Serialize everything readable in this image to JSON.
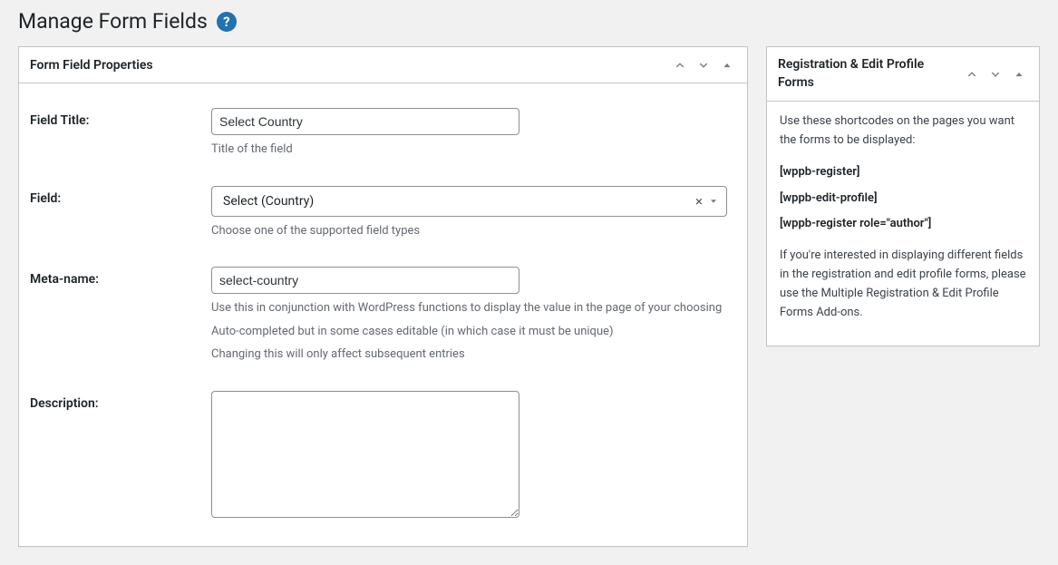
{
  "page": {
    "title": "Manage Form Fields"
  },
  "main_panel": {
    "title": "Form Field Properties",
    "fields": {
      "field_title": {
        "label": "Field Title:",
        "value": "Select Country",
        "help": "Title of the field"
      },
      "field_type": {
        "label": "Field:",
        "value": "Select (Country)",
        "help": "Choose one of the supported field types"
      },
      "meta_name": {
        "label": "Meta-name:",
        "value": "select-country",
        "help1": "Use this in conjunction with WordPress functions to display the value in the page of your choosing",
        "help2": "Auto-completed but in some cases editable (in which case it must be unique)",
        "help3": "Changing this will only affect subsequent entries"
      },
      "description": {
        "label": "Description:",
        "value": ""
      }
    }
  },
  "side_panel": {
    "title": "Registration & Edit Profile Forms",
    "intro": "Use these shortcodes on the pages you want the forms to be displayed:",
    "shortcodes": [
      "[wppb-register]",
      "[wppb-edit-profile]",
      "[wppb-register role=\"author\"]"
    ],
    "outro": "If you're interested in displaying different fields in the registration and edit profile forms, please use the Multiple Registration & Edit Profile Forms Add-ons."
  }
}
